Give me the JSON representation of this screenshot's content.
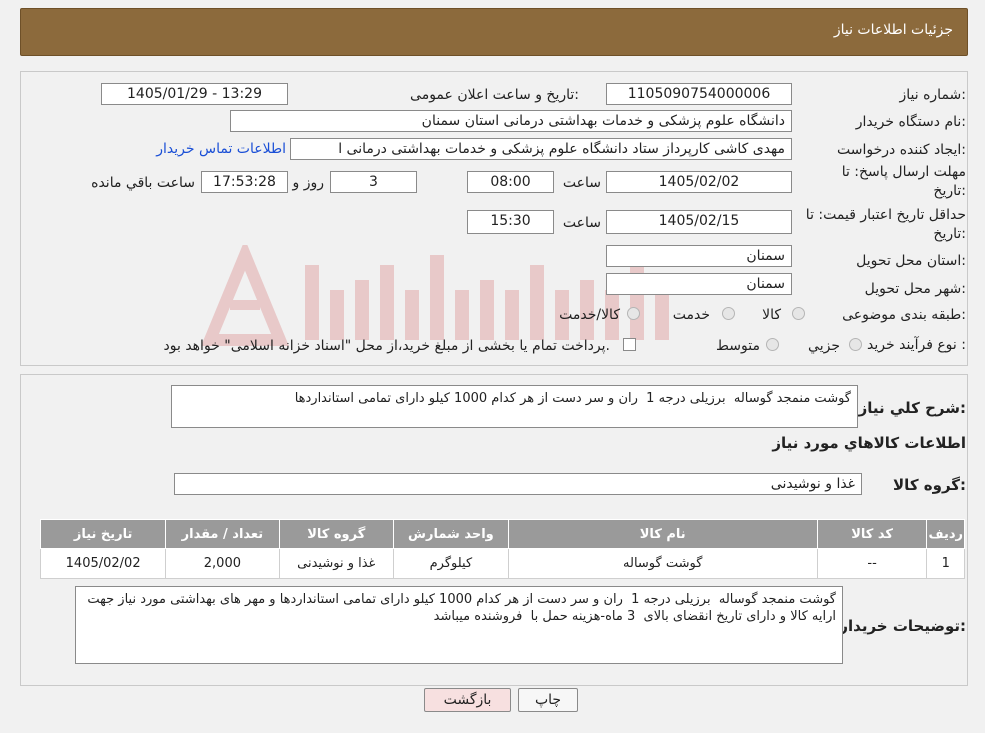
{
  "page": {
    "title": "جزئیات اطلاعات نیاز"
  },
  "labels": {
    "need_number": "شماره نیاز:",
    "announce_datetime": "تاریخ و ساعت اعلان عمومی:",
    "buyer_org": "نام دستگاه خریدار:",
    "requester": "ایجاد کننده درخواست:",
    "contact_link": "اطلاعات تماس خریدار",
    "deadline_line1": "مهلت ارسال پاسخ: تا",
    "deadline_line2": "تاریخ:",
    "time": "ساعت",
    "day_and": "روز و",
    "remaining": "ساعت باقي مانده",
    "validity_line1": "حداقل تاریخ اعتبار قیمت: تا",
    "validity_line2": "تاریخ:",
    "province": "استان محل تحویل:",
    "city": "شهر محل تحویل:",
    "category": "طبقه بندی موضوعی:",
    "process_type": "نوع فرآیند خرید :",
    "general_desc": "شرح کلي نياز:",
    "goods_info": "اطلاعات كالاهاي مورد نياز",
    "goods_group": "گروه کالا:",
    "buyer_notes": "توضیحات خریدار:"
  },
  "fields": {
    "need_number": "1105090754000006",
    "announce_datetime": "1405/01/29 - 13:29",
    "buyer_org": "دانشگاه علوم پزشکی و خدمات بهداشتی  درمانی استان سمنان",
    "requester": "مهدی کاشی کارپرداز ستاد دانشگاه علوم پزشکی و خدمات بهداشتی  درمانی ا",
    "deadline_date": "1405/02/02",
    "deadline_time": "08:00",
    "deadline_days": "3",
    "deadline_remaining": "17:53:28",
    "validity_date": "1405/02/15",
    "validity_time": "15:30",
    "province": "سمنان",
    "city": "سمنان",
    "general_desc": "گوشت منمجد گوساله  برزیلی درجه 1  ران و سر دست از هر کدام 1000 کیلو دارای تمامی استانداردها",
    "goods_group": "غذا و نوشیدنی",
    "buyer_notes": "گوشت منمجد گوساله  برزیلی درجه 1  ران و سر دست از هر کدام 1000 کیلو دارای تمامی استانداردها و مهر های بهداشتی مورد نیاز جهت ارایه کالا و دارای تاریخ انقضای بالای  3 ماه-هزینه حمل با  فروشنده میباشد"
  },
  "category_options": {
    "goods": "کالا",
    "service": "خدمت",
    "goods_service": "کالا/خدمت"
  },
  "process_options": {
    "partial": "جزیي",
    "medium": "متوسط",
    "treasury_note": "پرداخت تمام یا بخشی از مبلغ خرید،از محل \"اسناد خزانه اسلامی\" خواهد بود."
  },
  "table": {
    "headers": {
      "row": "ردیف",
      "code": "کد کالا",
      "name": "نام کالا",
      "unit": "واحد شمارش",
      "group": "گروه کالا",
      "qty": "تعداد / مقدار",
      "date": "تاریخ نیاز"
    },
    "rows": [
      {
        "row": "1",
        "code": "--",
        "name": "گوشت گوساله",
        "unit": "کیلوگرم",
        "group": "غذا و نوشیدنی",
        "qty": "2,000",
        "date": "1405/02/02"
      }
    ]
  },
  "buttons": {
    "print": "چاپ",
    "back": "بازگشت"
  },
  "colors": {
    "title_bar": "#8c6a3c",
    "table_header": "#9a9a9a",
    "link": "#1a4fd6",
    "back_button": "#f7e0e0"
  }
}
